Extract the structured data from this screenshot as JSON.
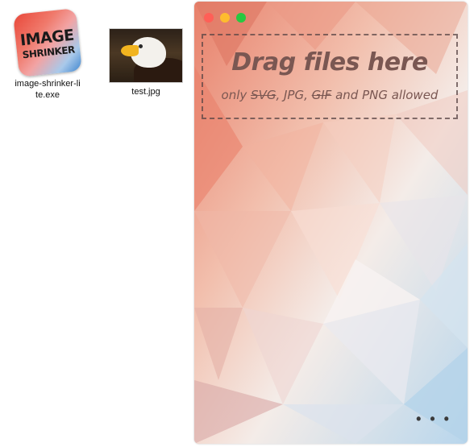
{
  "desktop": {
    "files": [
      {
        "name": "image-shrinker-li\nte.exe",
        "icon": "image-shrinker-app-icon",
        "icon_text_1": "IMAGE",
        "icon_text_2": "SHRINKER"
      },
      {
        "name": "test.jpg",
        "icon": "eagle-photo-thumbnail"
      }
    ]
  },
  "window": {
    "controls": [
      {
        "name": "close",
        "color": "#ff5f57"
      },
      {
        "name": "minimize",
        "color": "#febc2e"
      },
      {
        "name": "zoom",
        "color": "#28c840"
      }
    ],
    "dropzone": {
      "title": "Drag files here",
      "subtitle_parts": [
        "only ",
        "SVG",
        ", JPG, ",
        "GIF",
        " and PNG allowed"
      ]
    },
    "more_label": "• • •"
  }
}
